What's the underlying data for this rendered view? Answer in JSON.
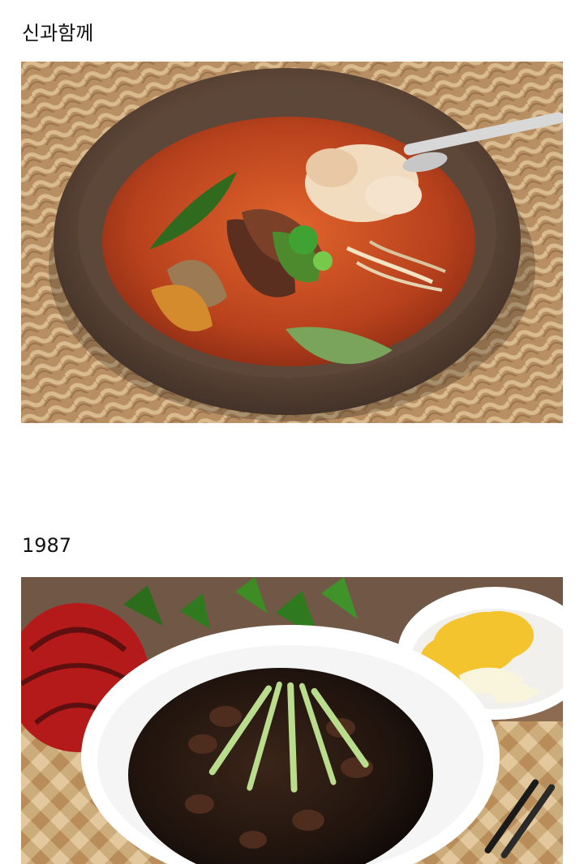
{
  "posts": [
    {
      "title": "신과함께",
      "image": {
        "subject": "yukgaejang-rice-soup-photo",
        "colors": {
          "mat": "#b88f63",
          "bowl": "#6d5544",
          "soup": "#c94a21",
          "rice": "#f1dcc0",
          "greens": "#4d8a2d"
        }
      }
    },
    {
      "title": "1987",
      "image": {
        "subject": "jajangmyeon-with-danmuji-photo",
        "colors": {
          "sauce": "#1f130d",
          "cucumber": "#b9dd8c",
          "plate": "#ffffff",
          "danmuji": "#f3c42d",
          "mat": "#c5a06d"
        }
      }
    }
  ]
}
